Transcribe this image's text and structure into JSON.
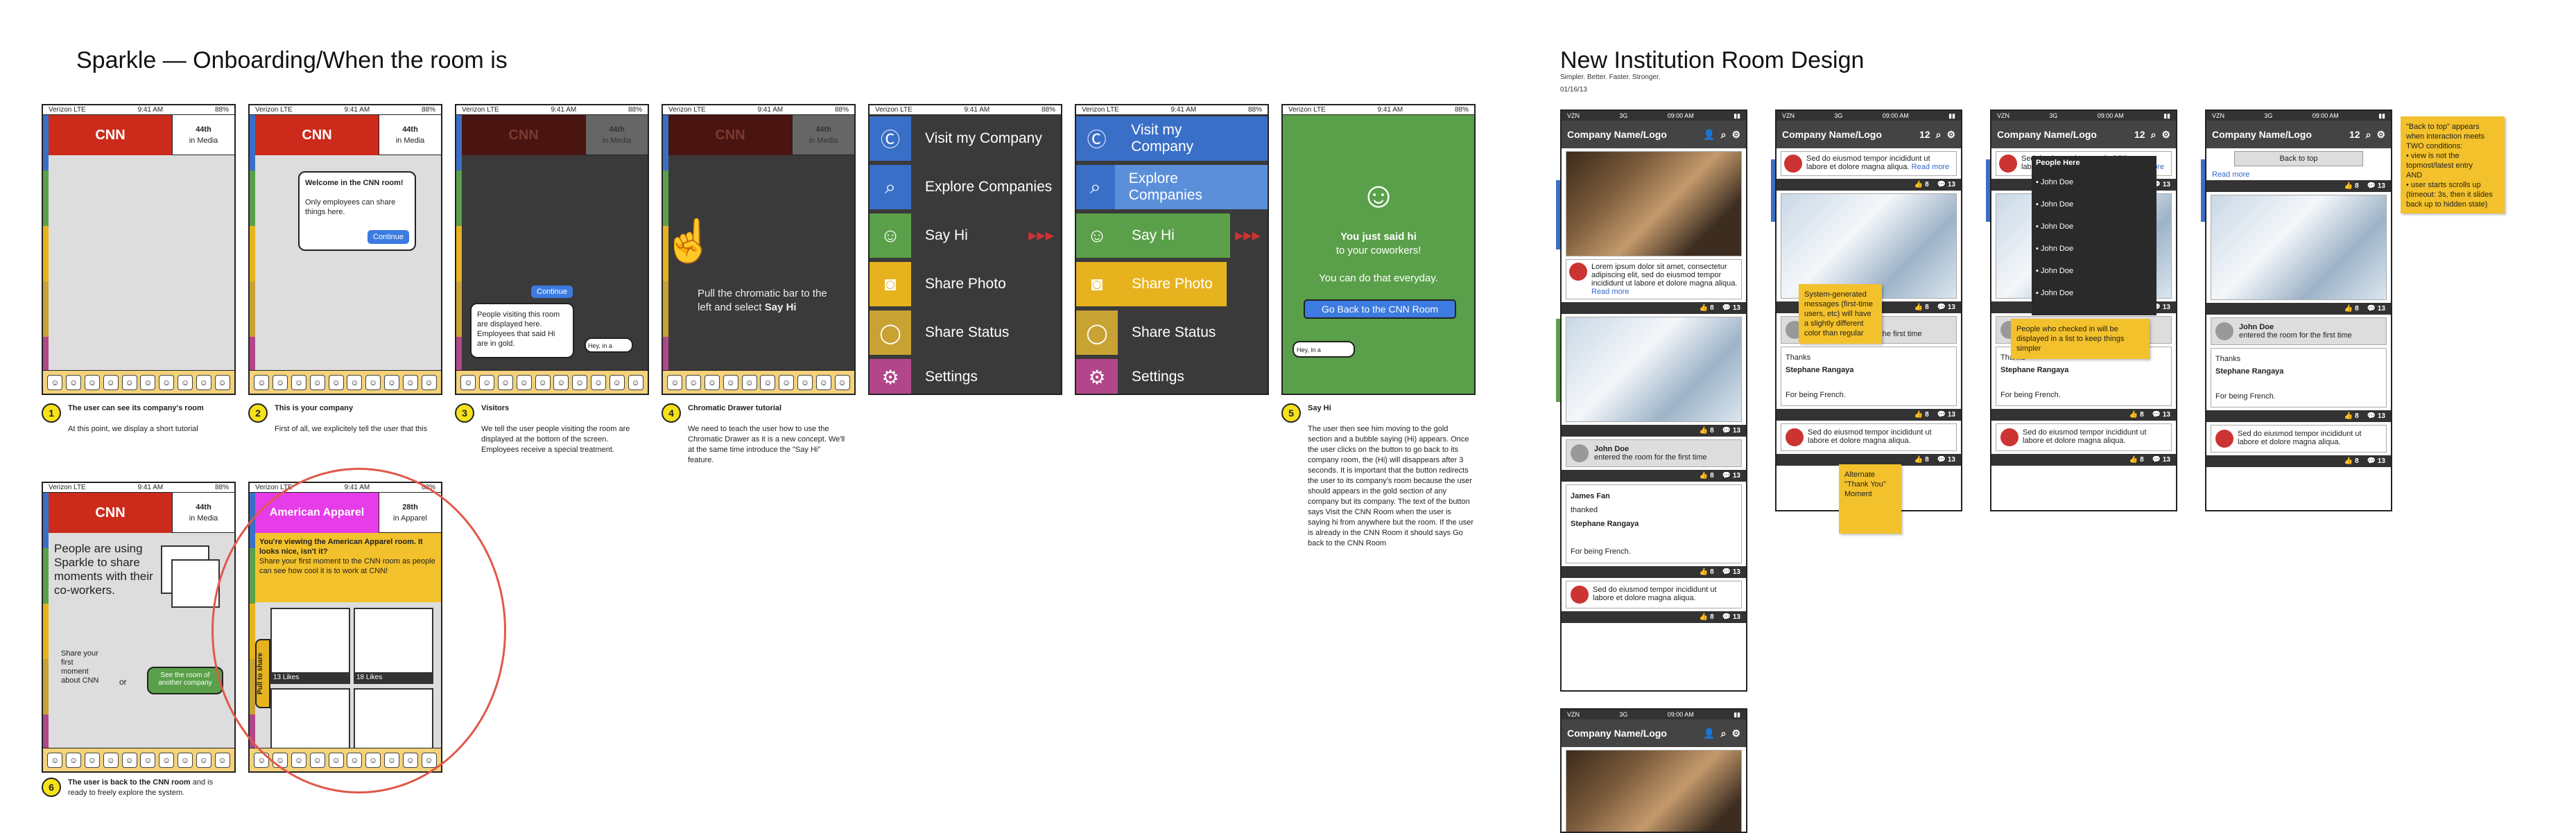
{
  "left_title": "Sparkle — Onboarding/When the room is",
  "right_title": "New Institution Room Design",
  "right_sub1": "Simpler. Better. Faster. Stronger.",
  "right_sub2": "01/16/13",
  "status": {
    "carrier": "Verizon LTE",
    "time": "9:41 AM",
    "battery": "88%"
  },
  "cnn": {
    "brand": "CNN",
    "rank": "44th",
    "rank_sub": "in Media"
  },
  "aa": {
    "brand": "American Apparel",
    "rank": "28th",
    "rank_sub": "in Apparel"
  },
  "s2": {
    "dialog": "Welcome in the CNN room!",
    "dialog2": "Only employees can share things here.",
    "btn": "Continue"
  },
  "s3": {
    "btn": "Continue",
    "dialog": "People visiting this room are displayed here. Employees that said Hi are in gold.",
    "bubble": "Hey, in a"
  },
  "s4": {
    "text1": "Pull the chromatic bar to the left and select ",
    "bold": "Say Hi"
  },
  "menu": [
    {
      "icon": "cc",
      "label": "Visit my Company"
    },
    {
      "icon": "🔍",
      "label": "Explore Companies"
    },
    {
      "icon": "☺",
      "label": "Say Hi"
    },
    {
      "icon": "📷",
      "label": "Share Photo"
    },
    {
      "icon": "💬",
      "label": "Share Status"
    },
    {
      "icon": "⚙",
      "label": "Settings"
    }
  ],
  "s7": {
    "smile": "☺",
    "l1": "You just said hi",
    "l2": "to your coworkers!",
    "l3": "You can do that everyday.",
    "btn": "Go Back to the CNN Room",
    "bubble": "Hey, in a"
  },
  "s8": {
    "text": "People are using Sparkle to share moments with their co-workers.",
    "share": "Share your first moment about CNN",
    "or": "or",
    "btn": "See the room of another company"
  },
  "s9": {
    "yellow1": "You're viewing the American Apparel room. It looks nice, isn't it?",
    "yellow2": "Share your first moment to the CNN room as people can see how cool it is to work at CNN!",
    "like1": "13 Likes",
    "like2": "18 Likes",
    "pull": "Pull to share"
  },
  "captions": [
    {
      "n": "1",
      "t": "The user can see its company's room",
      "d": "At this point, we display a short tutorial"
    },
    {
      "n": "2",
      "t": "This is your company",
      "d": "First of all, we explicitely tell the user that this"
    },
    {
      "n": "3",
      "t": "Visitors",
      "d": "We tell the user people visiting the room are displayed at the bottom of the screen. Employees receive a special treatment."
    },
    {
      "n": "4",
      "t": "Chromatic Drawer tutorial",
      "d": "We need to teach the user how to use the Chromatic Drawer as it is a new concept. We'll at the same time introduce the \"Say Hi\" feature."
    },
    {
      "n": "5",
      "t": "Say Hi",
      "d": "The user then see him moving to the gold section and a bubble saying (Hi) appears. Once the user clicks on the button to go back to its company room, the (Hi) will disappears after 3 seconds. It is important that the button redirects the user to its company's room because the user should appears in the gold section of any company but its company. The text of the button says Visit the CNN Room when the user is saying hi from anywhere but the room. If the user is already in the CNN Room it should says Go back to the CNN Room"
    },
    {
      "n": "6",
      "t": "The user is back to the CNN room",
      "d": "and is ready to freely explore the system."
    }
  ],
  "inst": {
    "carrier": "VZN",
    "net": "3G",
    "time": "09:00 AM",
    "company": "Company Name/Logo",
    "badge": "12",
    "likes": "8",
    "comments": "13",
    "read_more": "Read more",
    "lorem": "Lorem ipsum dolor sit amet, consectetur adipiscing elit, sed do eiusmod tempor incididunt ut labore et dolore magna aliqua.",
    "lorem2": "Sed do eiusmod tempor incididunt ut labore et dolore magna aliqua.",
    "john": "John Doe",
    "entered": "entered the room for the first time",
    "james": "James Fan",
    "thanked": "thanked",
    "stephane": "Stephane Rangaya",
    "thanks": "Thanks",
    "for_french": "For being French.",
    "people_here": "People Here",
    "back_top": "Back to top",
    "note1": "System-generated messages (first-time users, etc) will have a slightly different color than regular",
    "note2": "Alternate \"Thank You\" Moment",
    "note3": "People who checked in will be displayed in a list to keep things simpler",
    "note4": "\"Back to top\" appears when interaction meets TWO conditions:",
    "note4b": "view is not the topmost/latest entry",
    "note4c": "AND",
    "note4d": "user starts scrolls up (timeout: 3s, then it slides back up to hidden state)"
  }
}
